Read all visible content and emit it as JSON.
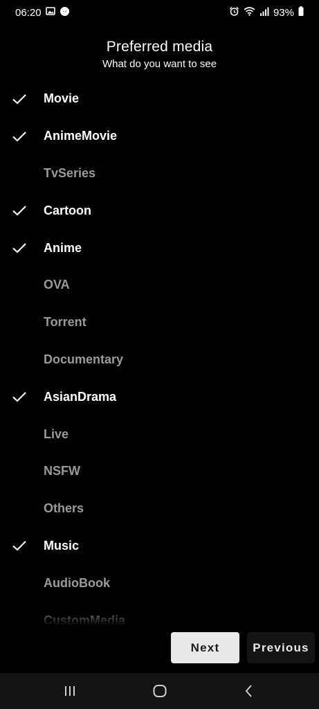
{
  "status_bar": {
    "time": "06:20",
    "battery": "93%",
    "icons_left": [
      "image-icon",
      "messenger-icon"
    ],
    "icons_right": [
      "alarm-icon",
      "wifi-icon",
      "signal-icon",
      "battery-icon"
    ]
  },
  "header": {
    "title": "Preferred media",
    "subtitle": "What do you want to see"
  },
  "media": [
    {
      "label": "Movie",
      "selected": true
    },
    {
      "label": "AnimeMovie",
      "selected": true
    },
    {
      "label": "TvSeries",
      "selected": false
    },
    {
      "label": "Cartoon",
      "selected": true
    },
    {
      "label": "Anime",
      "selected": true
    },
    {
      "label": "OVA",
      "selected": false
    },
    {
      "label": "Torrent",
      "selected": false
    },
    {
      "label": "Documentary",
      "selected": false
    },
    {
      "label": "AsianDrama",
      "selected": true
    },
    {
      "label": "Live",
      "selected": false
    },
    {
      "label": "NSFW",
      "selected": false
    },
    {
      "label": "Others",
      "selected": false
    },
    {
      "label": "Music",
      "selected": true
    },
    {
      "label": "AudioBook",
      "selected": false
    },
    {
      "label": "CustomMedia",
      "selected": false
    }
  ],
  "buttons": {
    "next_label": "Next",
    "previous_label": "Previous"
  },
  "nav_bar": {
    "items": [
      "recents-icon",
      "home-icon",
      "back-icon"
    ]
  },
  "colors": {
    "background": "#000000",
    "selected_text": "#ffffff",
    "unselected_text": "#9a9a9a",
    "next_button_bg": "#e9e9e9",
    "previous_button_bg": "#141414"
  }
}
